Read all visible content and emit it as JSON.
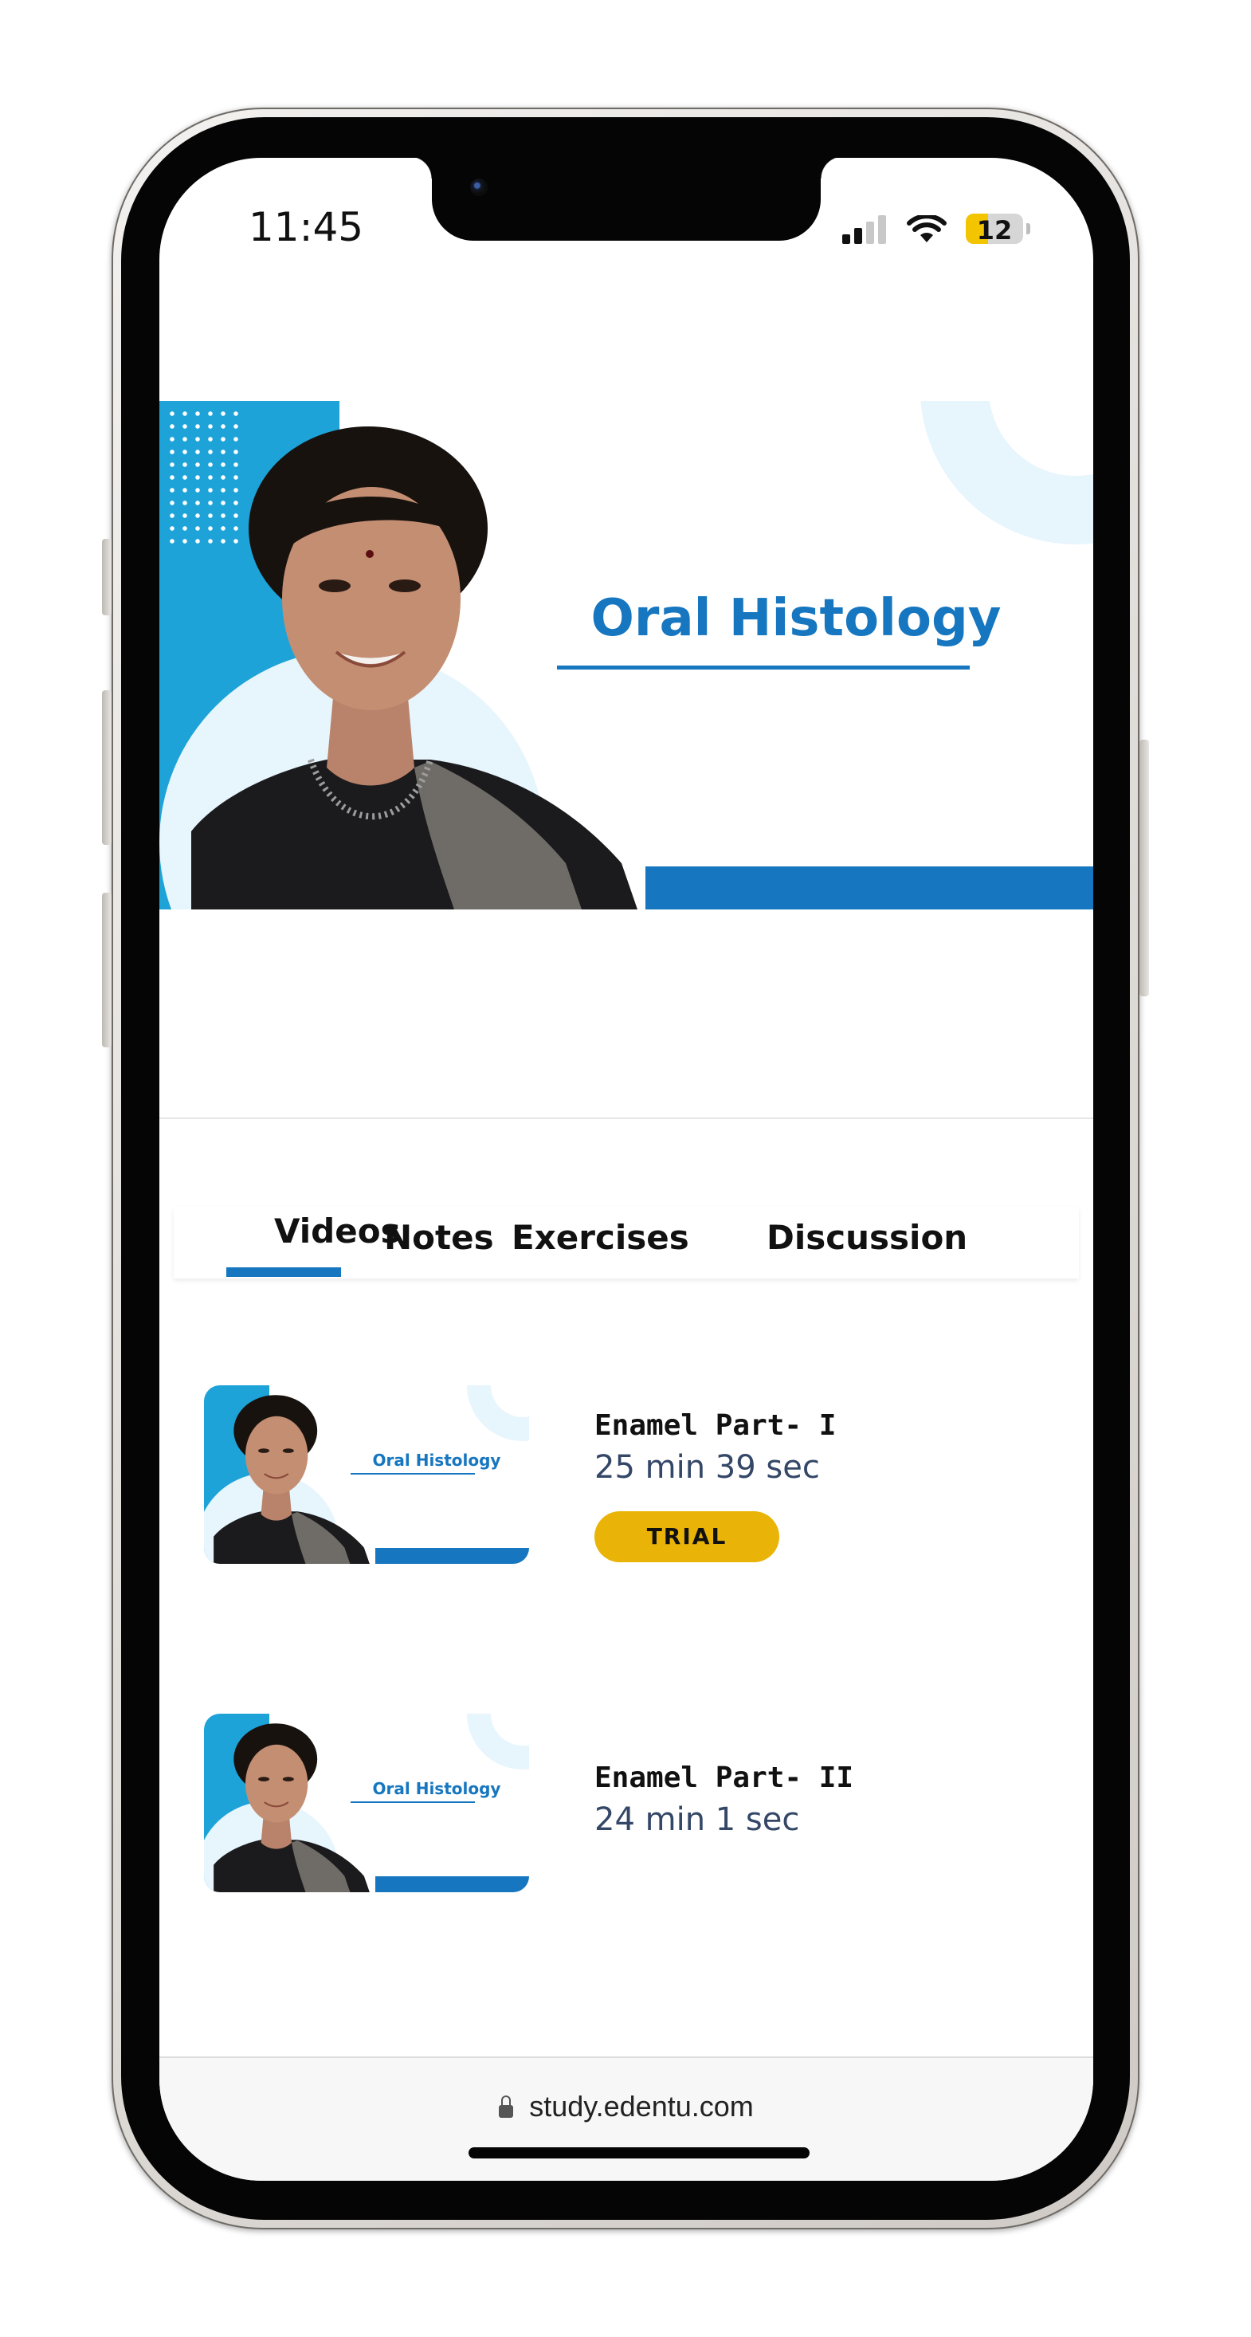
{
  "status_bar": {
    "time": "11:45",
    "battery_level": "12",
    "battery_fraction": 0.12
  },
  "hero": {
    "title": "Oral Histology"
  },
  "tabs": [
    {
      "label": "Videos",
      "active": true
    },
    {
      "label": "Notes",
      "active": false
    },
    {
      "label": "Exercises",
      "active": false
    },
    {
      "label": "Discussion",
      "active": false
    }
  ],
  "videos": [
    {
      "thumb_title": "Oral Histology",
      "title": "Enamel Part- I",
      "duration": "25 min 39 sec",
      "badge": "TRIAL"
    },
    {
      "thumb_title": "Oral Histology",
      "title": "Enamel Part- II",
      "duration": "24 min 1 sec"
    }
  ],
  "browser": {
    "url": "study.edentu.com"
  },
  "colors": {
    "brand_blue": "#1676bf",
    "accent_cyan": "#1ea3d8",
    "trial_yellow": "#eab308"
  },
  "icons": [
    "signal-icon",
    "wifi-icon",
    "battery-icon",
    "lock-icon"
  ]
}
